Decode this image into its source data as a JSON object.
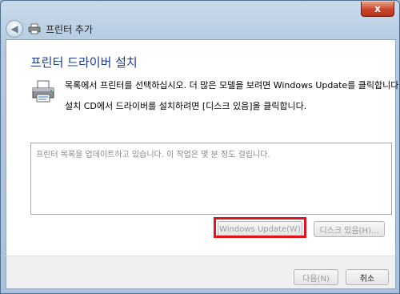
{
  "window": {
    "title": "프린터 추가",
    "close_glyph": "x"
  },
  "header": {
    "back_glyph": "◀"
  },
  "main": {
    "heading": "프린터 드라이버 설치",
    "instruction_1": "목록에서 프린터를 선택하십시오. 더 많은 모델을 보려면 Windows Update를 클릭합니다.",
    "instruction_2": "설치 CD에서 드라이버를 설치하려면 [디스크 있음]을 클릭합니다.",
    "list_status": "프린터 목록을 업데이트하고 있습니다. 이 작업은 몇 분 정도 걸립니다.",
    "windows_update_label": "Windows Update(W)",
    "have_disk_label": "디스크 있음(H)..."
  },
  "footer": {
    "next_label": "다음(N)",
    "cancel_label": "취소"
  },
  "colors": {
    "heading": "#1a3c8c",
    "highlight": "#e0141c",
    "close_button": "#c9442a"
  }
}
